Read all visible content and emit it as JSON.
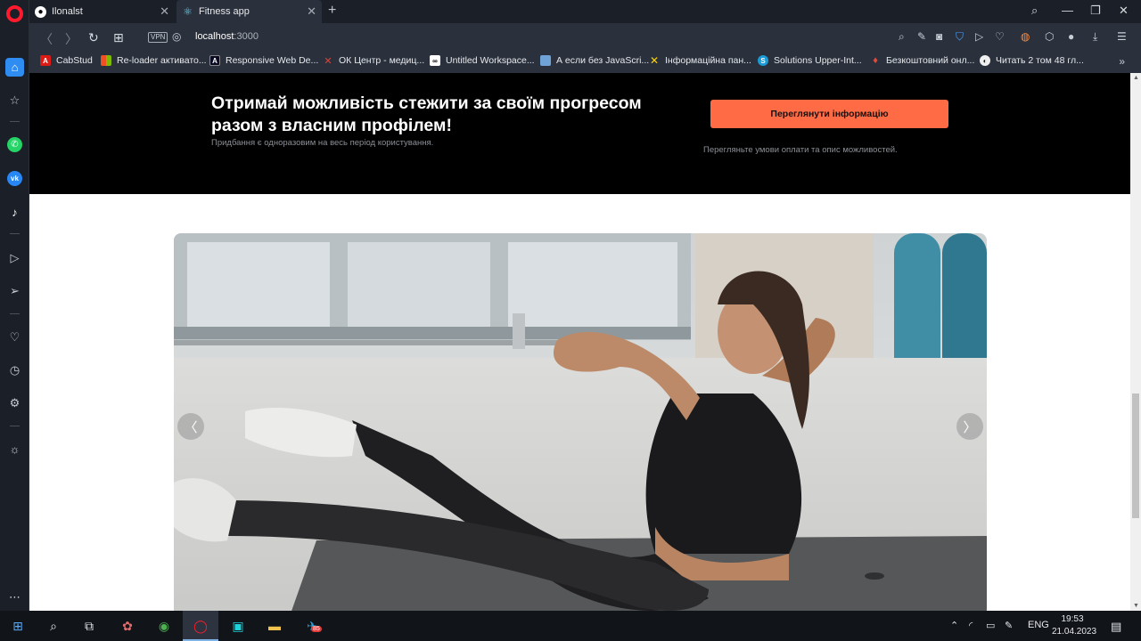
{
  "browser": {
    "tabs": [
      {
        "title": "Ilonalst",
        "icon": "github-icon"
      },
      {
        "title": "Fitness app",
        "icon": "react-icon",
        "active": true
      }
    ],
    "url": {
      "host": "localhost",
      "port": ":3000"
    },
    "vpn_label": "VPN",
    "bookmarks": [
      {
        "label": "CabStud",
        "icon": "angular-icon",
        "color": "#dd1b16"
      },
      {
        "label": "Re-loader активато...",
        "icon": "windows-icon",
        "color": "#f25022"
      },
      {
        "label": "Responsive Web De...",
        "icon": "freecodecamp-icon",
        "color": "#0a0a23"
      },
      {
        "label": "ОК Центр - медиц...",
        "icon": "ok-center-icon",
        "color": "#d9443b"
      },
      {
        "label": "Untitled Workspace...",
        "icon": "workspace-icon",
        "color": "#ffffff"
      },
      {
        "label": "А если без JavaScri...",
        "icon": "site-icon",
        "color": "#6fa3d8"
      },
      {
        "label": "Інформаційна пан...",
        "icon": "ukraine-icon",
        "color": "#ffd500"
      },
      {
        "label": "Solutions Upper-Int...",
        "icon": "solutions-icon",
        "color": "#1a9bd7"
      },
      {
        "label": "Безкоштовний онл...",
        "icon": "pin-icon",
        "color": "#e34b3c"
      },
      {
        "label": "Читать 2 том 48 гл...",
        "icon": "moon-icon",
        "color": "#f0f0f0"
      }
    ]
  },
  "page": {
    "promo": {
      "title": "Отримай можливість стежити за своїм прогресом разом з власним профілем!",
      "subtitle": "Придбання є одноразовим на весь період користування.",
      "button": "Переглянути інформацію",
      "note": "Перегляньте умови оплати та опис можливостей."
    },
    "slider": {
      "prev": "〈",
      "next": "〉"
    }
  },
  "taskbar": {
    "lang": "ENG",
    "time": "19:53",
    "date": "21.04.2023",
    "telegram_badge": "85"
  },
  "colors": {
    "accent": "#ff6b45",
    "promo_bg": "#000000"
  }
}
